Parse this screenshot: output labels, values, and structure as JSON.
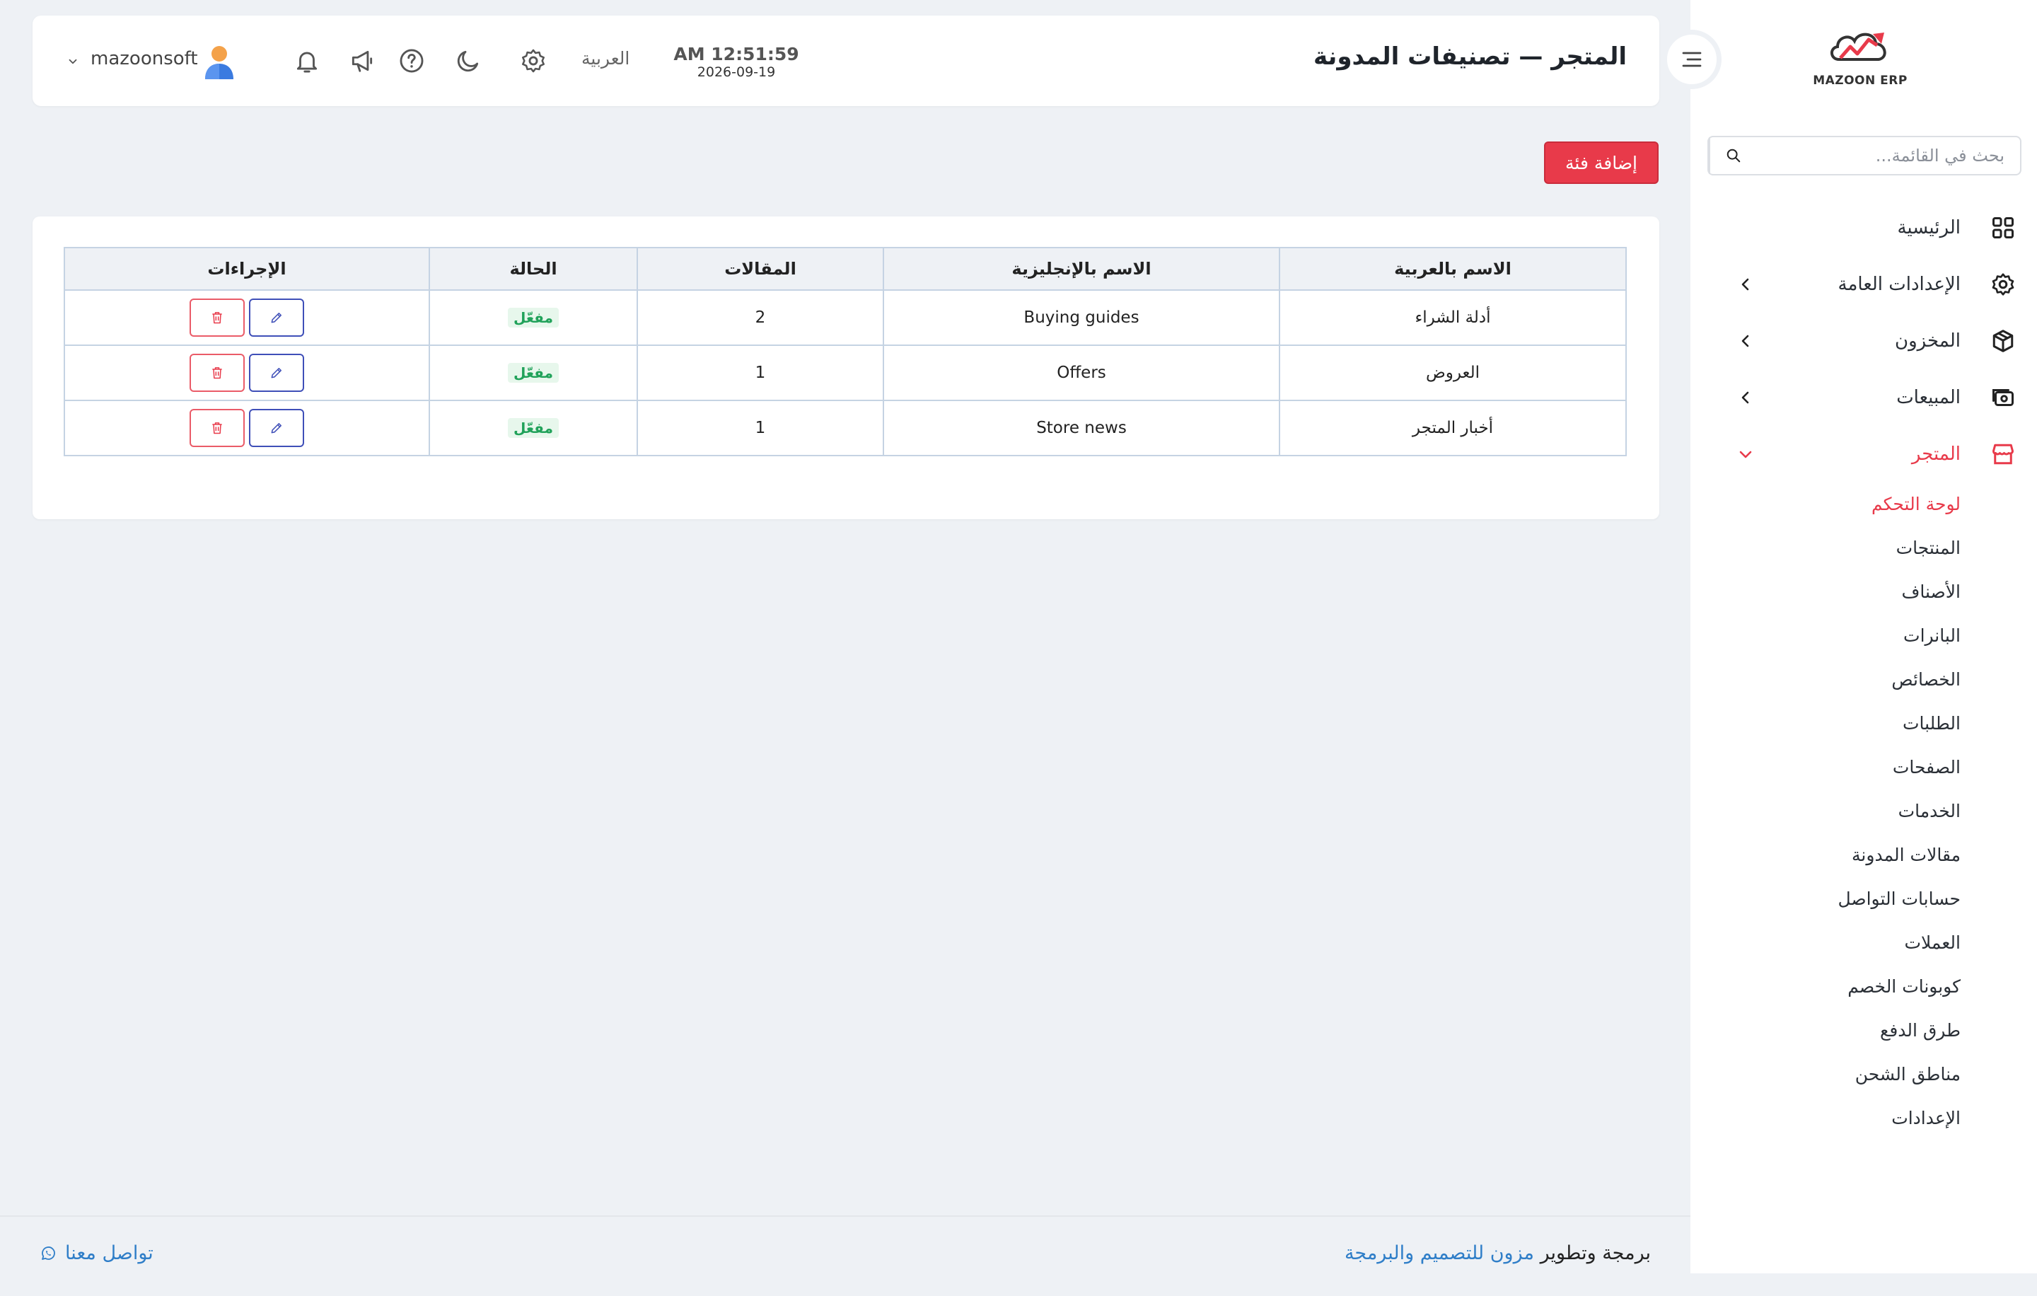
{
  "brand": {
    "logo_text": "MAZOON ERP",
    "logo_tag": "ERP.ERP"
  },
  "sidebar": {
    "search_placeholder": "بحث في القائمة...",
    "items": [
      {
        "label": "الرئيسية",
        "icon": "grid-icon",
        "has_children": false
      },
      {
        "label": "الإعدادات العامة",
        "icon": "gear-icon",
        "has_children": true
      },
      {
        "label": "المخزون",
        "icon": "box-icon",
        "has_children": true
      },
      {
        "label": "المبيعات",
        "icon": "cash-icon",
        "has_children": true
      },
      {
        "label": "المتجر",
        "icon": "store-icon",
        "has_children": true,
        "expanded": true
      }
    ],
    "store_submenu": [
      "لوحة التحكم",
      "المنتجات",
      "الأصناف",
      "البانرات",
      "الخصائص",
      "الطلبات",
      "الصفحات",
      "الخدمات",
      "مقالات المدونة",
      "حسابات التواصل",
      "العملات",
      "كوبونات الخصم",
      "طرق الدفع",
      "مناطق الشحن",
      "الإعدادات"
    ],
    "active_subitem_index": 0
  },
  "header": {
    "title": "المتجر — تصنيفات المدونة",
    "time": "AM 12:51:59",
    "date": "2026-09-19",
    "language": "العربية",
    "username": "mazoonsoft"
  },
  "main": {
    "add_button_label": "إضافة فئة",
    "table": {
      "headers": {
        "name_ar": "الاسم بالعربية",
        "name_en": "الاسم بالإنجليزية",
        "articles": "المقالات",
        "status": "الحالة",
        "actions": "الإجراءات"
      },
      "rows": [
        {
          "name_ar": "أدلة الشراء",
          "name_en": "Buying guides",
          "articles": "2",
          "status": "مفعّل"
        },
        {
          "name_ar": "العروض",
          "name_en": "Offers",
          "articles": "1",
          "status": "مفعّل"
        },
        {
          "name_ar": "أخبار المتجر",
          "name_en": "Store news",
          "articles": "1",
          "status": "مفعّل"
        }
      ]
    }
  },
  "footer": {
    "credits_prefix": "برمجة وتطوير",
    "credits_link": "مزون للتصميم والبرمجة",
    "contact": "تواصل معنا"
  },
  "colors": {
    "accent": "#e83a4a",
    "link": "#2f7ec8",
    "success": "#21a25a",
    "edit": "#3f4fb8"
  }
}
